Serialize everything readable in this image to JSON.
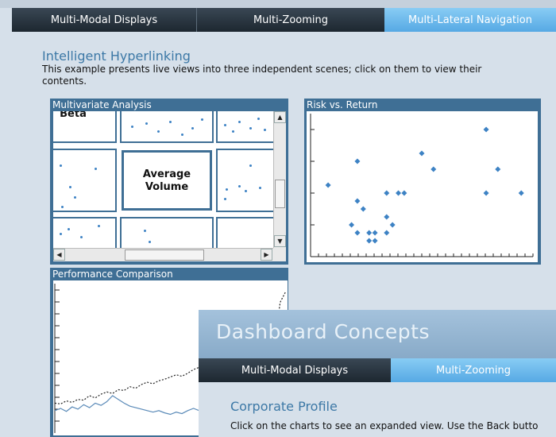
{
  "tabs": [
    {
      "label": "Multi-Modal Displays",
      "active": false
    },
    {
      "label": "Multi-Zooming",
      "active": false
    },
    {
      "label": "Multi-Lateral Navigation",
      "active": true
    }
  ],
  "section": {
    "title": "Intelligent Hyperlinking",
    "description": "This example presents live views into three independent scenes; click on them to view their contents."
  },
  "panels": {
    "multivariate": {
      "title": "Multivariate Analysis",
      "cells": {
        "beta": "Beta",
        "average_volume": "Average\nVolume"
      }
    },
    "risk": {
      "title": "Risk vs. Return"
    },
    "performance": {
      "title": "Performance Comparison"
    }
  },
  "dashboard": {
    "title": "Dashboard Concepts",
    "tabs": [
      {
        "label": "Multi-Modal Displays",
        "active": false
      },
      {
        "label": "Multi-Zooming",
        "active": true
      }
    ],
    "heading": "Corporate Profile",
    "description": "Click on the charts to see an expanded view. Use the Back butto"
  },
  "colors": {
    "accent": "#3c78a6",
    "panel": "#3f6f95",
    "tab_active": "#6ab8ec",
    "tab_dark": "#2a3540",
    "dot": "#3d82c4"
  },
  "chart_data": [
    {
      "type": "scatter",
      "title": "Risk vs. Return",
      "points": [
        [
          3,
          4.5
        ],
        [
          8,
          6
        ],
        [
          8,
          3.5
        ],
        [
          7,
          2
        ],
        [
          8,
          1.5
        ],
        [
          9,
          3
        ],
        [
          10,
          1
        ],
        [
          10,
          1.5
        ],
        [
          11,
          1
        ],
        [
          11,
          1.5
        ],
        [
          13,
          4
        ],
        [
          13,
          1.5
        ],
        [
          13,
          2.5
        ],
        [
          14,
          2
        ],
        [
          15,
          4
        ],
        [
          16,
          4
        ],
        [
          19,
          6.5
        ],
        [
          21,
          5.5
        ],
        [
          30,
          8
        ],
        [
          30,
          4
        ],
        [
          32,
          5.5
        ],
        [
          36,
          4
        ]
      ],
      "xlim": [
        0,
        38
      ],
      "ylim": [
        0,
        9
      ],
      "grid": false
    },
    {
      "type": "line",
      "title": "Performance Comparison",
      "series": [
        {
          "values": [
            40,
            39,
            43,
            41,
            45,
            44,
            50,
            47,
            52,
            55,
            53,
            58,
            57,
            62,
            60,
            65,
            68,
            66,
            70,
            72,
            75,
            78,
            76,
            80,
            85,
            88,
            86,
            90,
            92,
            95,
            98,
            97,
            100,
            103,
            106,
            110,
            108,
            112,
            118,
            175,
            190
          ]
        },
        {
          "values": [
            30,
            33,
            29,
            35,
            32,
            38,
            34,
            40,
            37,
            42,
            50,
            45,
            40,
            36,
            34,
            32,
            30,
            28,
            30,
            27,
            25,
            28,
            26,
            30,
            33,
            30,
            28,
            26,
            27,
            25,
            24,
            26,
            25,
            27,
            28,
            26,
            30,
            29,
            31,
            30,
            32
          ]
        }
      ],
      "ylim": [
        0,
        200
      ]
    }
  ]
}
